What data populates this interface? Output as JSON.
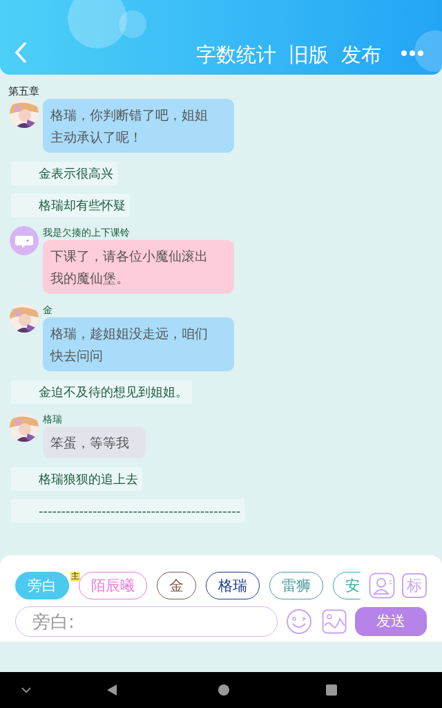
{
  "header": {
    "actions": [
      "字数统计",
      "旧版",
      "发布"
    ]
  },
  "chapter": "第五章",
  "messages": [
    {
      "kind": "bubble",
      "color": "#a8dcfa",
      "text": "格瑞，你判断错了吧，姐姐主动承认了呢！"
    },
    {
      "kind": "narration",
      "text": "金表示很高兴"
    },
    {
      "kind": "narration",
      "text": "格瑞却有些怀疑"
    },
    {
      "kind": "bubble",
      "avatar": {
        "kind": "icon"
      },
      "name": "我是欠揍的上下课铃",
      "color": "#ffcdd9",
      "text": "下课了，请各位小魔仙滚出我的魔仙堡。"
    },
    {
      "kind": "bubble",
      "name": "金",
      "color": "#a8dcfa",
      "text": "格瑞，趁姐姐没走远，咱们快去问问"
    },
    {
      "kind": "narration",
      "text": "金迫不及待的想见到姐姐。"
    },
    {
      "kind": "bubble",
      "name": "格瑞",
      "color": "#e2e4ec",
      "text": "笨蛋，等等我"
    },
    {
      "kind": "narration",
      "text": "格瑞狼狈的追上去"
    },
    {
      "kind": "narration",
      "text": "---------------------------------------------"
    }
  ],
  "roles": [
    {
      "label": "旁白",
      "color": "#4cc9ef",
      "selected": true
    },
    {
      "label": "陌辰曦",
      "color": "#e879d8",
      "selected": false,
      "badge": "主"
    },
    {
      "label": "金",
      "color": "#7a5a4a",
      "selected": false
    },
    {
      "label": "格瑞",
      "color": "#1e3a8a",
      "selected": false
    },
    {
      "label": "雷狮",
      "color": "#4a9a9a",
      "selected": false
    },
    {
      "label": "安",
      "color": "#2bb09a",
      "selected": false
    }
  ],
  "mark_button": "标",
  "input": {
    "placeholder": "旁白:"
  },
  "send": "发送"
}
